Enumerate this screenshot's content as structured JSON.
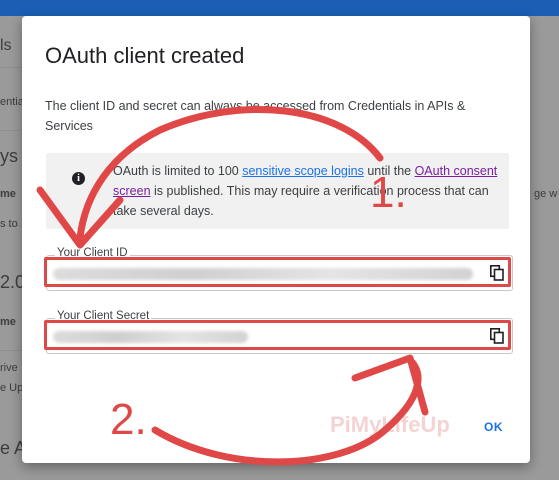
{
  "background": {
    "left_items": [
      "ls",
      "entials",
      "ys",
      "me",
      "s to",
      "2.0",
      "me",
      "rive",
      "e Up",
      "e A"
    ],
    "right_items": [
      "ge w"
    ]
  },
  "dialog": {
    "title": "OAuth client created",
    "description": "The client ID and secret can always be accessed from Credentials in APIs & Services",
    "info": {
      "icon": "info-icon",
      "text_1": "OAuth is limited to 100 ",
      "link_1": "sensitive scope logins",
      "text_2": " until the ",
      "link_2": "OAuth consent screen",
      "text_3": " is published. This may require a verification process that can take several days."
    },
    "client_id": {
      "label": "Your Client ID",
      "value_hidden": true
    },
    "client_secret": {
      "label": "Your Client Secret",
      "value_hidden": true
    },
    "ok_label": "OK"
  },
  "annotations": {
    "step_1": "1.",
    "step_2": "2.",
    "color": "#e04848"
  },
  "watermark": "PiMyLifeUp",
  "colors": {
    "link": "#1a73e8",
    "visited_link": "#7b1fa2",
    "topbar": "#1a5fb4"
  }
}
